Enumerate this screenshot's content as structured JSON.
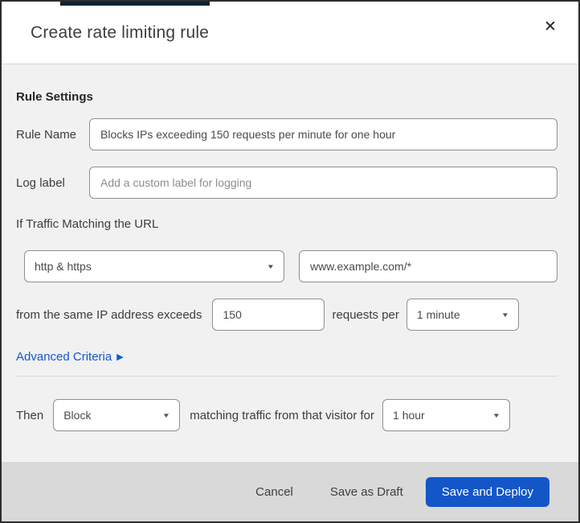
{
  "icons": {
    "close": "✕",
    "chevron_down": "▼",
    "chevron_right": "▶"
  },
  "colors": {
    "accent_blue": "#1158d1",
    "primary_button_blue": "#1456c8",
    "body_background": "#f1f1f1",
    "footer_background": "#d9d9d9",
    "top_strip": "#10222f"
  },
  "dialog": {
    "title": "Create rate limiting rule",
    "section_heading": "Rule Settings",
    "rule_name": {
      "label": "Rule Name",
      "value": "Blocks IPs exceeding 150 requests per minute for one hour"
    },
    "log_label": {
      "label": "Log label",
      "placeholder": "Add a custom label for logging"
    },
    "traffic_match": {
      "heading": "If Traffic Matching the URL",
      "scheme_selected": "http & https",
      "url_value": "www.example.com/*"
    },
    "threshold": {
      "prefix": "from the same IP address exceeds",
      "requests_value": "150",
      "middle": "requests per",
      "period_selected": "1 minute"
    },
    "advanced_criteria_label": "Advanced Criteria",
    "action": {
      "prefix": "Then",
      "action_selected": "Block",
      "middle": "matching traffic from that visitor for",
      "duration_selected": "1 hour"
    },
    "footer": {
      "cancel_label": "Cancel",
      "save_draft_label": "Save as Draft",
      "save_deploy_label": "Save and Deploy"
    }
  }
}
